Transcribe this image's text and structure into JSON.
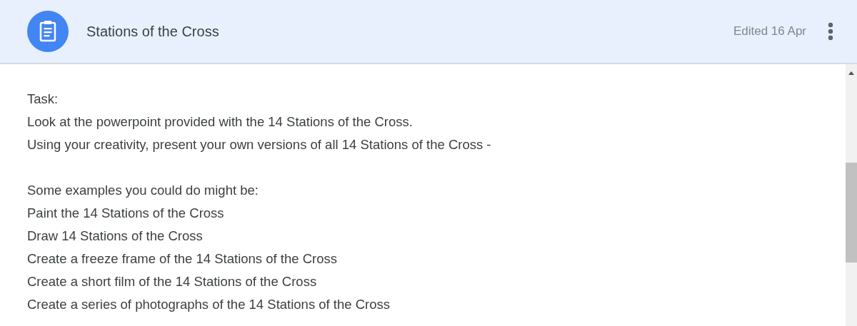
{
  "header": {
    "title": "Stations of the Cross",
    "edited": "Edited 16 Apr"
  },
  "paragraphs": [
    [
      "Task:",
      "Look at the powerpoint provided with the 14 Stations of the Cross.",
      "Using your creativity, present your own versions of all 14 Stations of the Cross -"
    ],
    [
      "Some examples you could do might be:",
      "Paint the 14 Stations of the Cross",
      "Draw 14 Stations of the Cross",
      "Create a freeze frame of the 14 Stations of the Cross",
      "Create a short film of the 14 Stations of the Cross",
      "Create a series of photographs of the 14 Stations of the Cross"
    ]
  ]
}
